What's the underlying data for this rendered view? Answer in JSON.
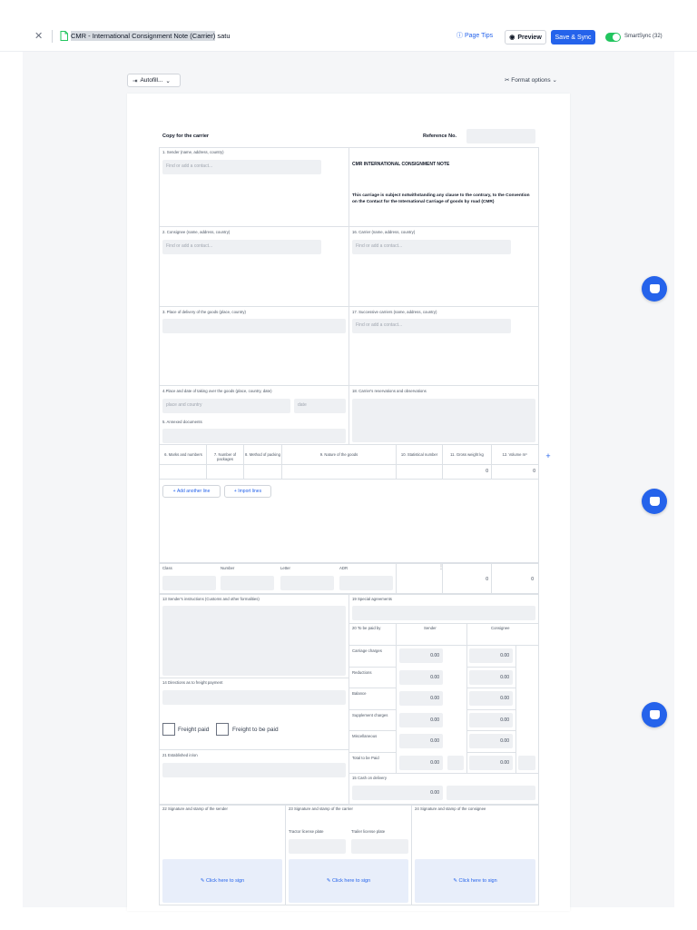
{
  "topbar": {
    "close_icon": "close-icon",
    "title_highlight": "CMR - International Consignment Note (Carrier)",
    "title_suffix": " satu",
    "page_tips": "Page Tips",
    "preview": "Preview",
    "save_sync": "Save & Sync",
    "smartsync": "SmartSync (32)",
    "smartsync_on": true
  },
  "toolbar": {
    "autofill": "Autofill...",
    "format_options": "Format options"
  },
  "form": {
    "copy_for": "Copy for the carrier",
    "reference_label": "Reference No.",
    "reference_value": "",
    "sender_label": "1. Sender (name, address, country)",
    "sender_placeholder": "Find or add a contact...",
    "cmr_title": "CMR INTERNATIONAL CONSIGNMENT NOTE",
    "cmr_text": "This carriage is subject notwithstanding any clause to the contrary, to the Convention on the Contact for the International Carriage of goods by road (CMR)",
    "consignee_label": "2. Consignee (name, address, country)",
    "consignee_placeholder": "Find or add a contact...",
    "carrier_label": "16. Carrier (name, address, country)",
    "carrier_placeholder": "Find or add a contact...",
    "delivery_label": "3. Place of delivery of the goods (place, country)",
    "successive_label": "17. Successive carriers (name, address, country)",
    "successive_placeholder": "Find or add a contact...",
    "taking_over_label": "4.Place and date of taking over the goods (place, country, date)",
    "place_placeholder": "place and country",
    "date_placeholder": "date",
    "reservations_label": "18. Carrier's reservations and observations",
    "annexed_label": "5. Annexed documents",
    "goods_headers": [
      "6. Marks and numbers",
      "7. Number of packages",
      "8. Method of packing",
      "9. Nature of the goods",
      "10. Statistical number",
      "11. Gross weight kg",
      "12. Volume m³"
    ],
    "gross_weight_total": "0",
    "volume_total": "0",
    "add_line": "Add another line",
    "import_lines": "Import lines",
    "adr_headers": [
      "Class",
      "Number",
      "Letter",
      "ADR"
    ],
    "adr_weight": "0",
    "adr_volume": "0",
    "instructions_label": "13 Sender's instructions (Customs and other formalities)",
    "special_label": "19 Special agreements",
    "to_be_paid_label": "20 To be paid by",
    "sender_col": "Sender",
    "consignee_col": "Consignee",
    "charges": [
      {
        "label": "Carriage charges",
        "sender": "0.00",
        "consignee": "0.00"
      },
      {
        "label": "Reductions",
        "sender": "0.00",
        "consignee": "0.00"
      },
      {
        "label": "Balance",
        "sender": "0.00",
        "consignee": "0.00"
      },
      {
        "label": "Supplement charges",
        "sender": "0.00",
        "consignee": "0.00"
      },
      {
        "label": "Miscellaneous",
        "sender": "0.00",
        "consignee": "0.00"
      },
      {
        "label": "Total to be Paid",
        "sender": "0.00",
        "consignee": "0.00"
      }
    ],
    "directions_label": "14 Directions as to freight payment",
    "freight_paid": "Freight paid",
    "freight_to_be_paid": "Freight to be paid",
    "established_label": "21 Established in/on",
    "cash_label": "15 Cash on delivery",
    "cash_value": "0.00",
    "sig_sender_label": "22 Signature and stamp of the sender",
    "sig_carrier_label": "23 Signature and stamp of the carrier",
    "sig_consignee_label": "24 Signature and stamp of the consignee",
    "tractor_label": "Tractor license plate",
    "trailer_label": "Trailer license plate",
    "click_to_sign": "Click here to sign"
  },
  "colors": {
    "accent": "#2563eb",
    "toggle_on": "#22c55e",
    "field_bg": "#eef0f3",
    "sign_bg": "#e8eefa"
  }
}
